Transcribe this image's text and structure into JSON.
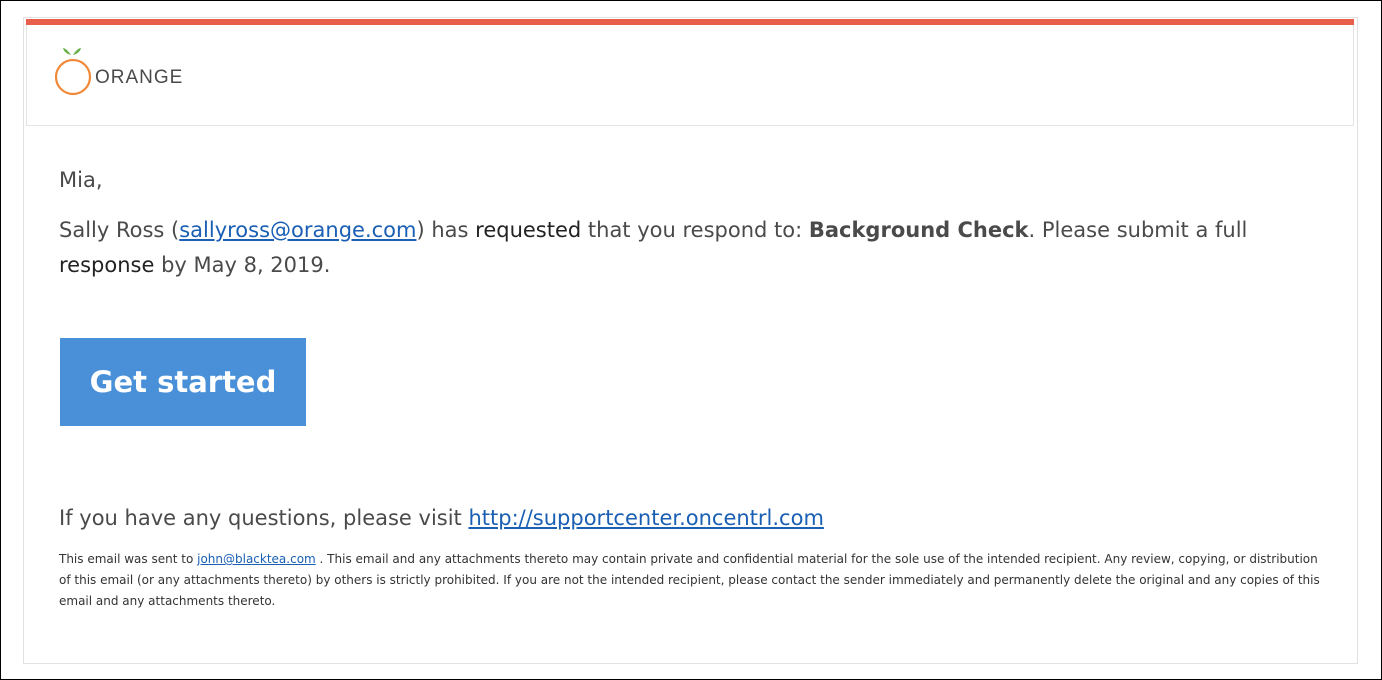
{
  "colors": {
    "accent_bar": "#e8604c",
    "button": "#4a90d9",
    "link": "#1a5fb4",
    "logo_ring": "#f08a3a",
    "logo_leaf": "#6ab04c"
  },
  "header": {
    "logo_icon": "orange-fruit-icon",
    "logo_text": "ORANGE"
  },
  "message": {
    "greeting": "Mia,",
    "requester_name": "Sally Ross (",
    "requester_email": "sallyross@orange.com",
    "text_1": ") has ",
    "text_requested": "requested",
    "text_2": " that you respond to: ",
    "request_title": "Background Check",
    "text_3": ". Please submit a full ",
    "text_response": "response",
    "text_4": " by May 8, 2019."
  },
  "cta": {
    "label": "Get started"
  },
  "questions": {
    "prefix": "If you have any questions, please visit ",
    "link": "http://supportcenter.oncentrl.com"
  },
  "legal": {
    "prefix": "This email was sent to ",
    "email": "john@blacktea.com",
    "suffix": " . This email and any attachments thereto may contain private and confidential material for the sole use of the intended recipient. Any review, copying, or distribution of this email (or any attachments thereto) by others is strictly prohibited. If you are not the intended recipient, please contact the sender immediately and permanently delete the original and any copies of this email and any attachments thereto."
  }
}
